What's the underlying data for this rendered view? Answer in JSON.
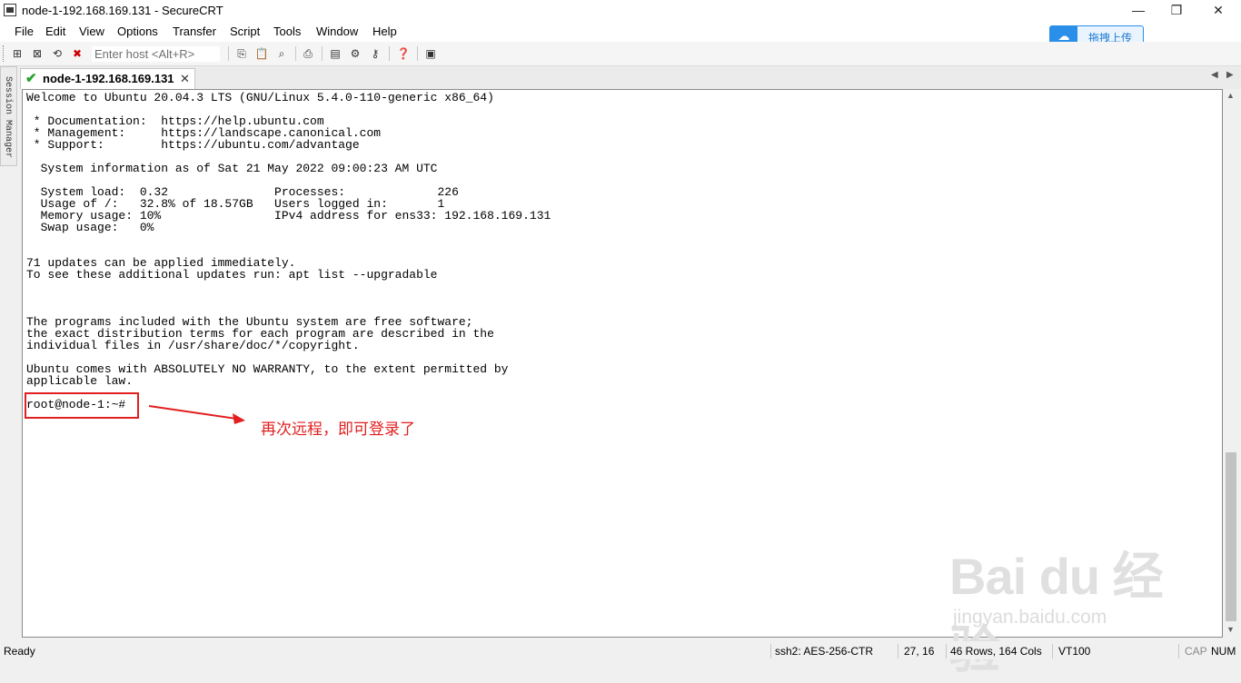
{
  "window": {
    "title": "node-1-192.168.169.131 - SecureCRT",
    "minimize_glyph": "—",
    "maximize_glyph": "❐",
    "close_glyph": "✕"
  },
  "menu": [
    "File",
    "Edit",
    "View",
    "Options",
    "Transfer",
    "Script",
    "Tools",
    "Window",
    "Help"
  ],
  "toolbar": {
    "host_placeholder": "Enter host <Alt+R>",
    "icons": [
      "quick-connect-icon",
      "connect-icon",
      "reconnect-icon",
      "disconnect-icon",
      "copy-icon",
      "paste-icon",
      "find-icon",
      "print-icon",
      "session-options-icon",
      "global-options-icon",
      "keymap-icon",
      "help-icon",
      "sftp-icon"
    ]
  },
  "baidu_upload": {
    "label": "拖拽上传",
    "accent": "#2a8fe8"
  },
  "session_manager": {
    "label": "Session Manager"
  },
  "tab": {
    "label": "node-1-192.168.169.131",
    "status_icon": "connected-check-icon",
    "status_color": "#22a32b"
  },
  "terminal": {
    "lines": [
      "Welcome to Ubuntu 20.04.3 LTS (GNU/Linux 5.4.0-110-generic x86_64)",
      "",
      " * Documentation:  https://help.ubuntu.com",
      " * Management:     https://landscape.canonical.com",
      " * Support:        https://ubuntu.com/advantage",
      "",
      "  System information as of Sat 21 May 2022 09:00:23 AM UTC",
      "",
      "  System load:  0.32               Processes:             226",
      "  Usage of /:   32.8% of 18.57GB   Users logged in:       1",
      "  Memory usage: 10%                IPv4 address for ens33: 192.168.169.131",
      "  Swap usage:   0%",
      "",
      "",
      "71 updates can be applied immediately.",
      "To see these additional updates run: apt list --upgradable",
      "",
      "",
      "",
      "The programs included with the Ubuntu system are free software;",
      "the exact distribution terms for each program are described in the",
      "individual files in /usr/share/doc/*/copyright.",
      "",
      "Ubuntu comes with ABSOLUTELY NO WARRANTY, to the extent permitted by",
      "applicable law.",
      "",
      "root@node-1:~#"
    ]
  },
  "annotation": {
    "text": "再次远程，即可登录了",
    "color": "#e21f1f"
  },
  "watermark": {
    "logo_text": "Bai du 经验",
    "url": "jingyan.baidu.com"
  },
  "statusbar": {
    "ready": "Ready",
    "encryption": "ssh2: AES-256-CTR",
    "cursor_pos": "27,  16",
    "dimensions": "46 Rows, 164 Cols",
    "emulation": "VT100",
    "cap": "CAP",
    "num": "NUM"
  }
}
